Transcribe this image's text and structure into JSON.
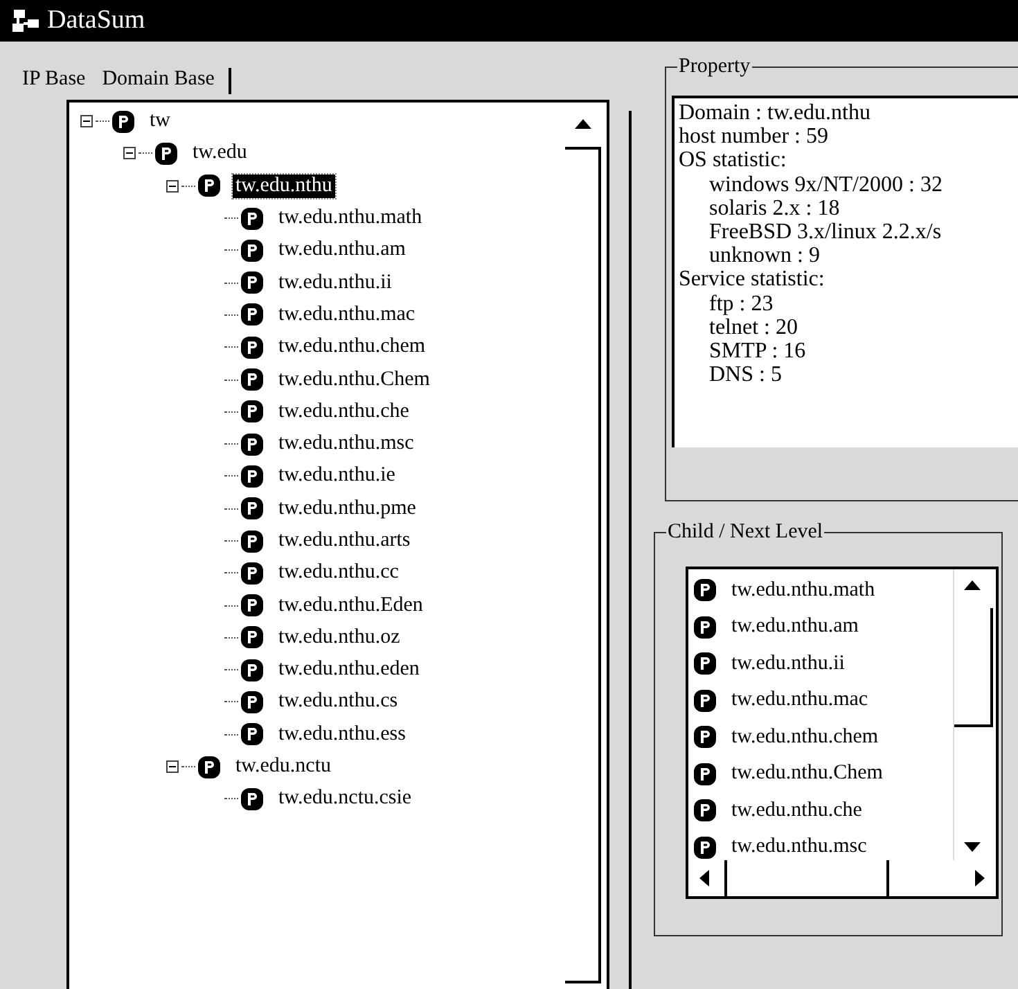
{
  "window": {
    "title": "DataSum"
  },
  "tabs": [
    {
      "label": "IP Base",
      "selected": false
    },
    {
      "label": "Domain Base",
      "selected": true
    }
  ],
  "tree": [
    {
      "label": "tw",
      "expanded": true,
      "selected": false,
      "children": [
        {
          "label": "tw.edu",
          "expanded": true,
          "selected": false,
          "children": [
            {
              "label": "tw.edu.nthu",
              "expanded": true,
              "selected": true,
              "children": [
                {
                  "label": "tw.edu.nthu.math",
                  "selected": false
                },
                {
                  "label": "tw.edu.nthu.am",
                  "selected": false
                },
                {
                  "label": "tw.edu.nthu.ii",
                  "selected": false
                },
                {
                  "label": "tw.edu.nthu.mac",
                  "selected": false
                },
                {
                  "label": "tw.edu.nthu.chem",
                  "selected": false
                },
                {
                  "label": "tw.edu.nthu.Chem",
                  "selected": false
                },
                {
                  "label": "tw.edu.nthu.che",
                  "selected": false
                },
                {
                  "label": "tw.edu.nthu.msc",
                  "selected": false
                },
                {
                  "label": "tw.edu.nthu.ie",
                  "selected": false
                },
                {
                  "label": "tw.edu.nthu.pme",
                  "selected": false
                },
                {
                  "label": "tw.edu.nthu.arts",
                  "selected": false
                },
                {
                  "label": "tw.edu.nthu.cc",
                  "selected": false
                },
                {
                  "label": "tw.edu.nthu.Eden",
                  "selected": false
                },
                {
                  "label": "tw.edu.nthu.oz",
                  "selected": false
                },
                {
                  "label": "tw.edu.nthu.eden",
                  "selected": false
                },
                {
                  "label": "tw.edu.nthu.cs",
                  "selected": false
                },
                {
                  "label": "tw.edu.nthu.ess",
                  "selected": false
                }
              ]
            },
            {
              "label": "tw.edu.nctu",
              "expanded": true,
              "selected": false,
              "children": [
                {
                  "label": "tw.edu.nctu.csie",
                  "selected": false
                }
              ]
            }
          ]
        }
      ]
    }
  ],
  "property": {
    "title": "Property",
    "lines": [
      {
        "text": "Domain : tw.edu.nthu",
        "indent": false
      },
      {
        "text": "host number : 59",
        "indent": false
      },
      {
        "text": "OS statistic:",
        "indent": false
      },
      {
        "text": "windows 9x/NT/2000 : 32",
        "indent": true
      },
      {
        "text": "solaris 2.x : 18",
        "indent": true
      },
      {
        "text": "FreeBSD 3.x/linux 2.2.x/s",
        "indent": true
      },
      {
        "text": "unknown : 9",
        "indent": true
      },
      {
        "text": "Service statistic:",
        "indent": false
      },
      {
        "text": "ftp : 23",
        "indent": true
      },
      {
        "text": "telnet : 20",
        "indent": true
      },
      {
        "text": "SMTP : 16",
        "indent": true
      },
      {
        "text": "DNS : 5",
        "indent": true
      }
    ]
  },
  "child_list": {
    "title": "Child / Next Level",
    "items": [
      "tw.edu.nthu.math",
      "tw.edu.nthu.am",
      "tw.edu.nthu.ii",
      "tw.edu.nthu.mac",
      "tw.edu.nthu.chem",
      "tw.edu.nthu.Chem",
      "tw.edu.nthu.che",
      "tw.edu.nthu.msc"
    ]
  }
}
